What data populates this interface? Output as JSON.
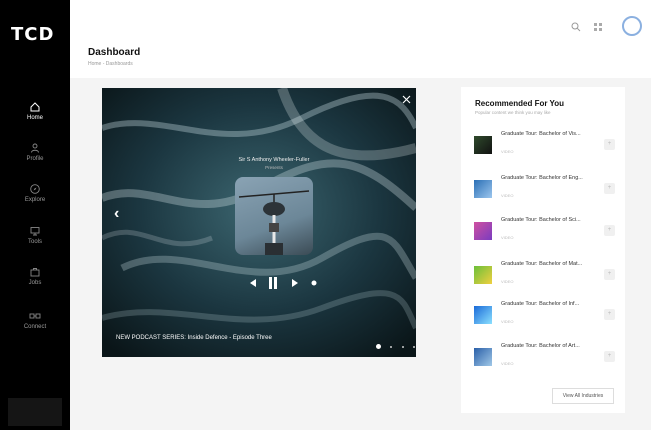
{
  "brand": {
    "logo_text": "TCD",
    "accent": "#8bb0e0"
  },
  "sidebar": {
    "items": [
      {
        "label": "Home",
        "icon": "home-icon",
        "active": true
      },
      {
        "label": "Profile",
        "icon": "person-icon",
        "active": false
      },
      {
        "label": "Explore",
        "icon": "compass-icon",
        "active": false
      },
      {
        "label": "Tools",
        "icon": "monitor-icon",
        "active": false
      },
      {
        "label": "Jobs",
        "icon": "briefcase-icon",
        "active": false
      },
      {
        "label": "Connect",
        "icon": "link-icon",
        "active": false
      }
    ]
  },
  "header": {
    "title": "Dashboard",
    "breadcrumb": "Home - Dashboards"
  },
  "player": {
    "track_title": "Sir S Anthony Wheeler-Fuller",
    "track_subtitle": "Presents",
    "caption": "NEW PODCAST SERIES: Inside Defence - Episode Three",
    "slides": 5,
    "active_slide": 1
  },
  "recommended": {
    "title": "Recommended For You",
    "subtitle": "Popular content we think you may like",
    "items": [
      {
        "title": "Graduate Tour: Bachelor of Vis...",
        "type": "VIDEO",
        "thumb": [
          "#2f4a2c",
          "#111111"
        ]
      },
      {
        "title": "Graduate Tour: Bachelor of Eng...",
        "type": "VIDEO",
        "thumb": [
          "#2a6fb5",
          "#9cc6ee"
        ]
      },
      {
        "title": "Graduate Tour: Bachelor of Sci...",
        "type": "VIDEO",
        "thumb": [
          "#d050a0",
          "#7a3cc0"
        ]
      },
      {
        "title": "Graduate Tour: Bachelor of Mat...",
        "type": "VIDEO",
        "thumb": [
          "#6bbf3a",
          "#f0d040"
        ]
      },
      {
        "title": "Graduate Tour: Bachelor of Inf...",
        "type": "VIDEO",
        "thumb": [
          "#1a6ad8",
          "#8be0ff"
        ]
      },
      {
        "title": "Graduate Tour: Bachelor of Art...",
        "type": "VIDEO",
        "thumb": [
          "#2a5fa8",
          "#a0c8e8"
        ]
      }
    ],
    "view_all_label": "View All Industries"
  }
}
